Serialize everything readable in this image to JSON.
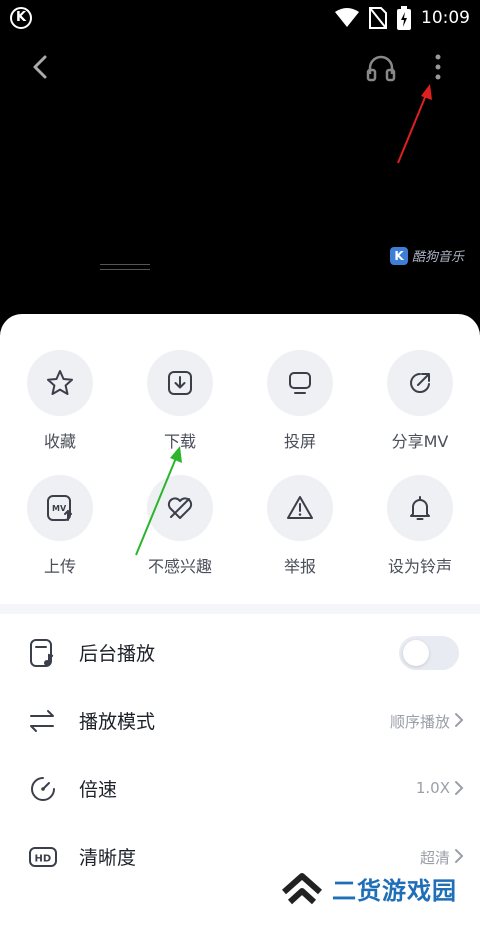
{
  "status_bar": {
    "time": "10:09",
    "logo": "K",
    "icons": [
      "wifi-icon",
      "no-sim-icon",
      "battery-charging-icon"
    ]
  },
  "topbar": {
    "icons": [
      "back-icon",
      "headphone-icon",
      "more-icon"
    ]
  },
  "watermark": {
    "logo": "K",
    "text": "酷狗音乐"
  },
  "actions": [
    {
      "label": "收藏",
      "icon": "star-icon"
    },
    {
      "label": "下载",
      "icon": "download-icon"
    },
    {
      "label": "投屏",
      "icon": "cast-icon"
    },
    {
      "label": "分享MV",
      "icon": "share-icon"
    },
    {
      "label": "上传",
      "icon": "upload-mv-icon"
    },
    {
      "label": "不感兴趣",
      "icon": "dislike-heart-icon"
    },
    {
      "label": "举报",
      "icon": "warning-icon"
    },
    {
      "label": "设为铃声",
      "icon": "bell-icon"
    }
  ],
  "settings": [
    {
      "label": "后台播放",
      "icon": "background-play-icon",
      "type": "toggle",
      "on": false
    },
    {
      "label": "播放模式",
      "icon": "play-mode-icon",
      "value": "顺序播放"
    },
    {
      "label": "倍速",
      "icon": "speed-icon",
      "value": "1.0X"
    },
    {
      "label": "清晰度",
      "icon": "hd-icon",
      "value": "超清"
    }
  ],
  "site_watermark": {
    "text": "二货游戏园"
  },
  "colors": {
    "annotation_red": "#e02020",
    "annotation_green": "#2bb52b",
    "watermark_blue": "#1e6fb8"
  }
}
